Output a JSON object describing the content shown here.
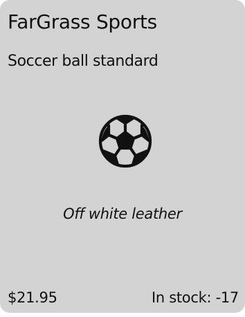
{
  "card": {
    "brand": "FarGrass Sports",
    "product_name": "Soccer ball standard",
    "icon": "soccer-ball-icon",
    "description": "Off white leather",
    "price": "$21.95",
    "stock": "In stock: -17"
  },
  "colors": {
    "card_background": "#d3d3d3",
    "text": "#111111"
  }
}
